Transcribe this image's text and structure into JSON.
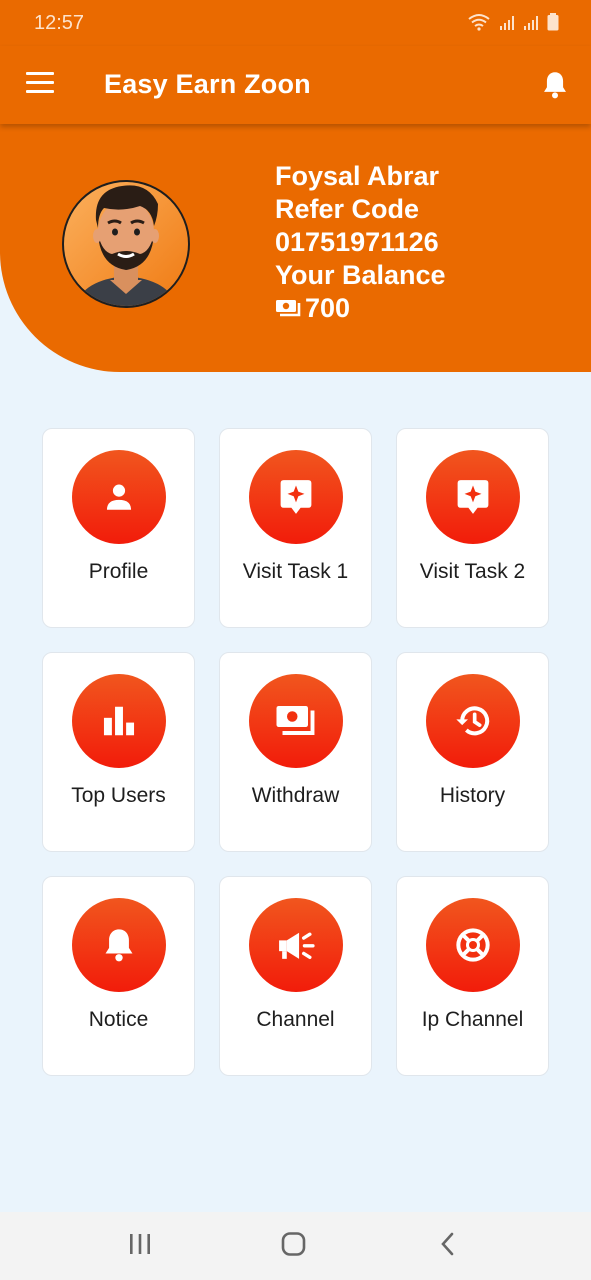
{
  "status_bar": {
    "time": "12:57"
  },
  "app_bar": {
    "title": "Easy Earn Zoon",
    "menu_icon": "hamburger-menu-icon",
    "notification_icon": "bell-icon"
  },
  "profile_header": {
    "name": "Foysal Abrar",
    "refer_code_label": "Refer Code",
    "refer_code": "01751971126",
    "balance_label": "Your Balance",
    "balance": "700",
    "balance_icon": "cash-icon"
  },
  "menu": {
    "items": [
      {
        "label": "Profile",
        "icon": "person-icon"
      },
      {
        "label": "Visit Task 1",
        "icon": "sparkle-badge-icon"
      },
      {
        "label": "Visit Task 2",
        "icon": "sparkle-badge-icon"
      },
      {
        "label": "Top Users",
        "icon": "bar-chart-icon"
      },
      {
        "label": "Withdraw",
        "icon": "cash-icon"
      },
      {
        "label": "History",
        "icon": "history-icon"
      },
      {
        "label": "Notice",
        "icon": "bell-icon"
      },
      {
        "label": "Channel",
        "icon": "megaphone-icon"
      },
      {
        "label": "Ip Channel",
        "icon": "lifebuoy-icon"
      }
    ]
  },
  "colors": {
    "primary": "#ea6a00",
    "icon_gradient_top": "#f1561e",
    "icon_gradient_bottom": "#f21c0a",
    "background": "#eaf4fc"
  }
}
